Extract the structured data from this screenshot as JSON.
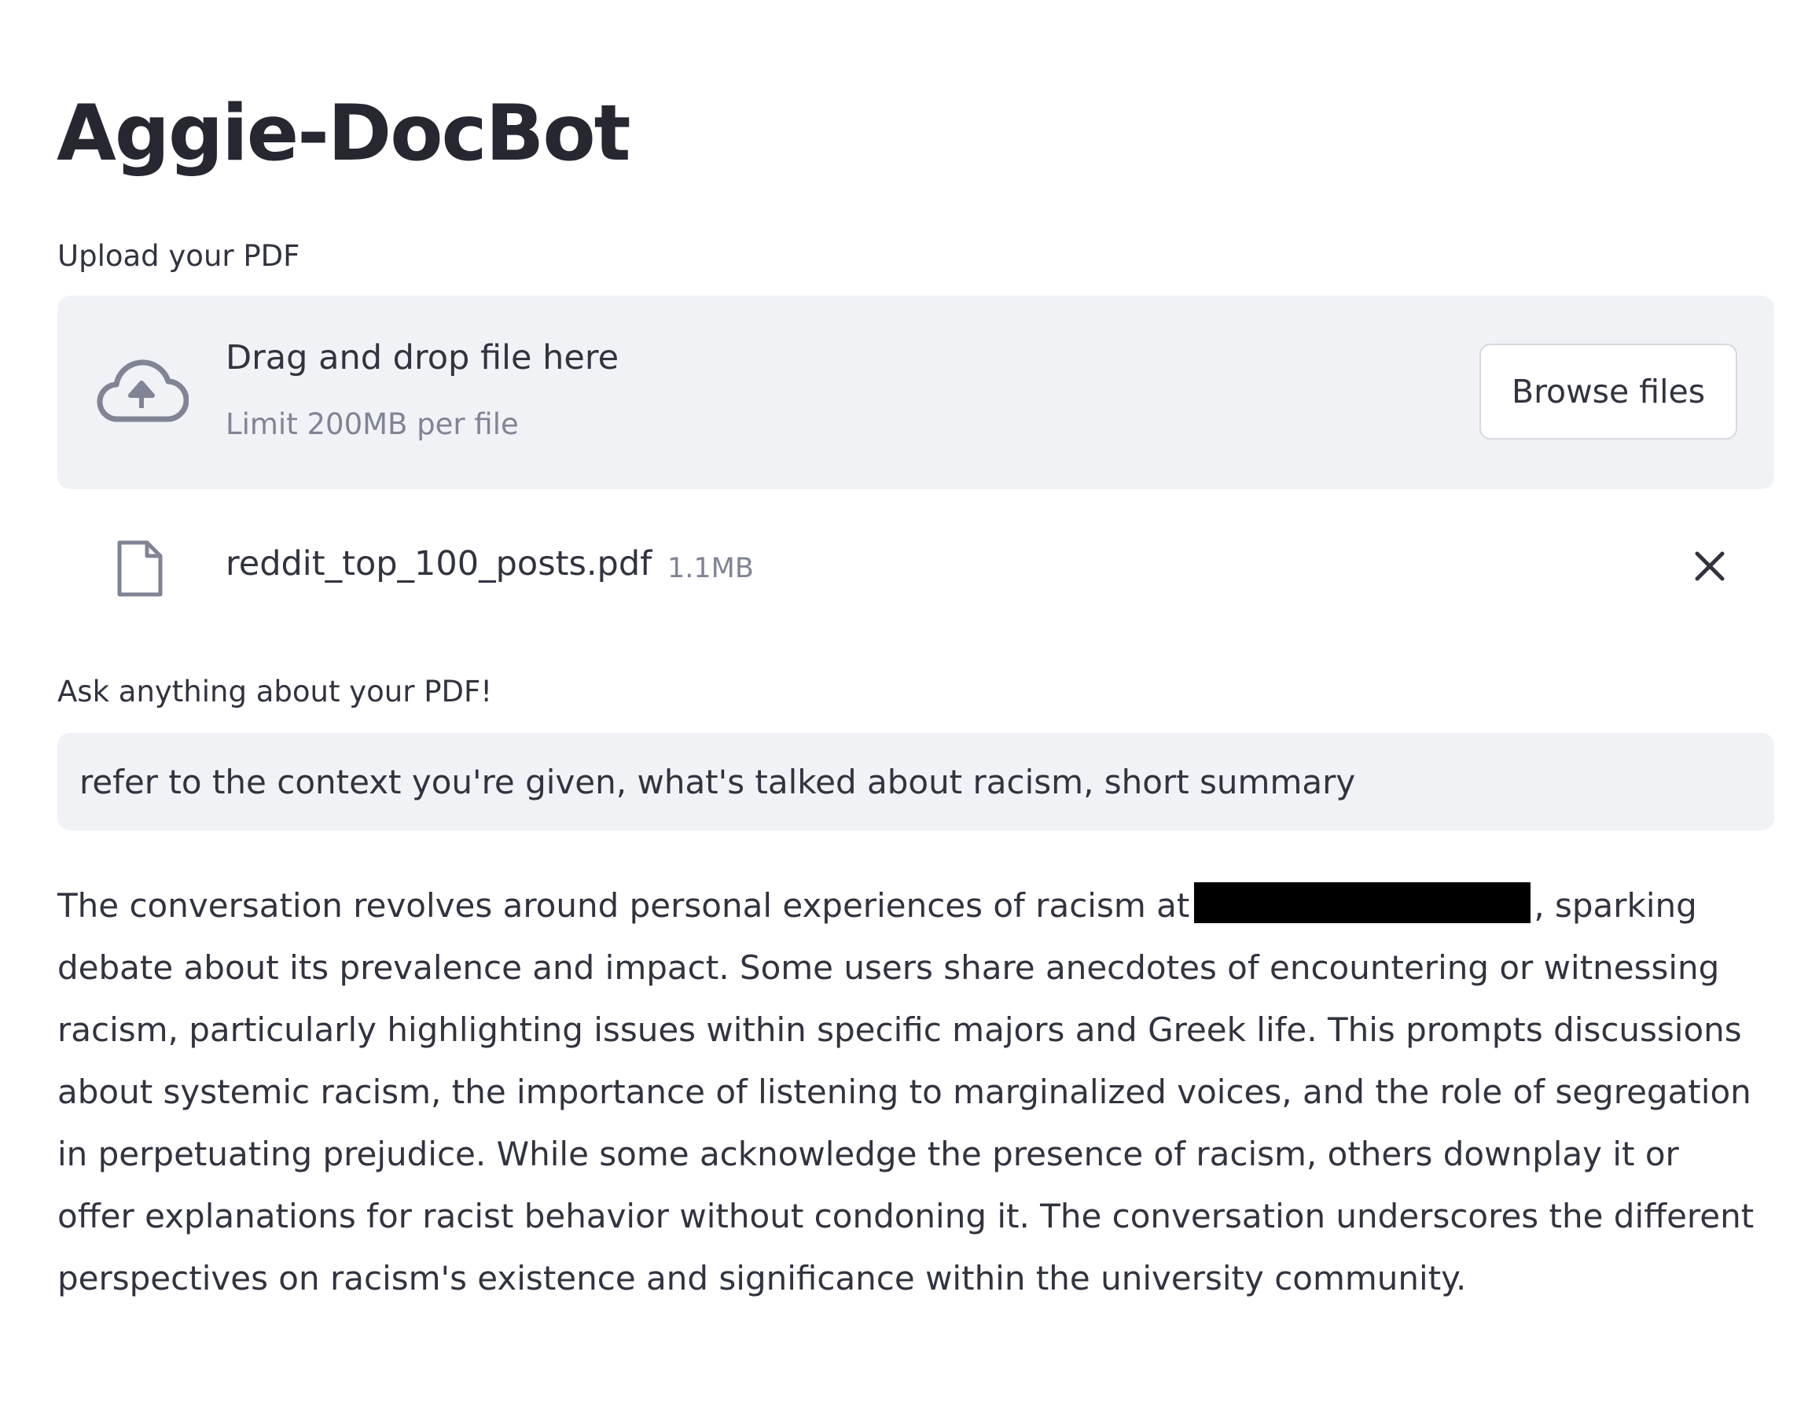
{
  "app": {
    "title": "Aggie-DocBot"
  },
  "uploader": {
    "label": "Upload your PDF",
    "drop_text": "Drag and drop file here",
    "limit_text": "Limit 200MB per file",
    "browse_label": "Browse files",
    "icon": "cloud-upload-icon"
  },
  "uploaded_file": {
    "name": "reddit_top_100_posts.pdf",
    "size": "1.1MB",
    "icon": "file-icon",
    "remove_icon": "close-icon"
  },
  "question": {
    "label": "Ask anything about your PDF!",
    "value": "refer to the context you're given, what's talked about racism, short summary"
  },
  "answer": {
    "text_before_redaction": "The conversation revolves around personal experiences of racism at",
    "text_after_redaction": ", sparking debate about its prevalence and impact. Some users share anecdotes of encountering or witnessing racism, particularly highlighting issues within specific majors and Greek life. This prompts discussions about systemic racism, the importance of listening to marginalized voices, and the role of segregation in perpetuating prejudice. While some acknowledge the presence of racism, others downplay it or offer explanations for racist behavior without condoning it. The conversation underscores the different perspectives on racism's existence and significance within the university community."
  },
  "colors": {
    "text": "#31333f",
    "muted": "#808495",
    "panel_bg": "#f0f2f6",
    "redaction": "#000000"
  }
}
